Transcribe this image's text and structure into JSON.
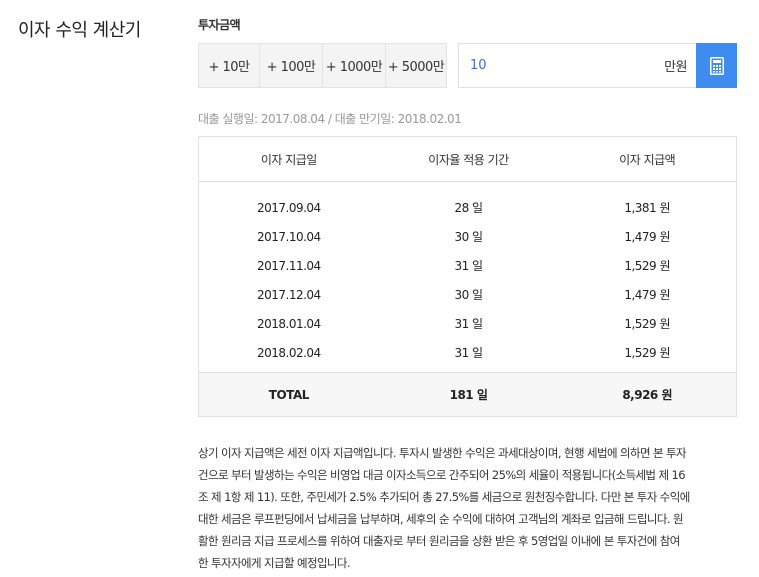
{
  "page_title": "이자 수익 계산기",
  "invest_label": "투자금액",
  "amount_buttons": [
    "+ 10만",
    "+ 100만",
    "+ 1000만",
    "+ 5000만"
  ],
  "amount_input": {
    "value": "10",
    "unit": "만원"
  },
  "calc_icon": "calculator-icon",
  "date_info": "대출 실행일: 2017.08.04 / 대출 만기일: 2018.02.01",
  "table": {
    "headers": [
      "이자 지급일",
      "이자율 적용 기간",
      "이자 지급액"
    ],
    "rows": [
      [
        "2017.09.04",
        "28 일",
        "1,381 원"
      ],
      [
        "2017.10.04",
        "30 일",
        "1,479 원"
      ],
      [
        "2017.11.04",
        "31 일",
        "1,529 원"
      ],
      [
        "2017.12.04",
        "30 일",
        "1,479 원"
      ],
      [
        "2018.01.04",
        "31 일",
        "1,529 원"
      ],
      [
        "2018.02.04",
        "31 일",
        "1,529 원"
      ]
    ],
    "total": [
      "TOTAL",
      "181 일",
      "8,926 원"
    ]
  },
  "notice_lines": [
    "상기 이자 지급액은 세전 이자 지급액입니다. 투자시 발생한 수익은 과세대상이며, 현행 세법에 의하면 본 투자",
    "건으로 부터 발생하는 수익은 비영업 대금 이자소득으로 간주되어 25%의 세율이 적용됩니다(소득세법 제 16",
    "조 제 1항 제 11). 또한, 주민세가 2.5% 추가되어 총 27.5%를 세금으로 원천징수합니다. 다만 본 투자 수익에",
    "대한 세금은 루프펀딩에서 납세금을 납부하며, 세후의 순 수익에 대하여 고객님의 계좌로 입금해 드립니다. 원",
    "활한 원리금 지급 프로세스를 위하여 대출자로 부터 원리금을 상환 받은 후 5영업일 이내에 본 투자건에 참여",
    "한 투자자에게 지급할 예정입니다."
  ]
}
